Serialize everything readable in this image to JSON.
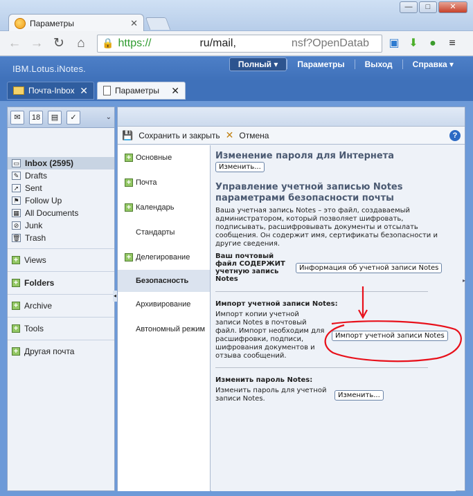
{
  "browser": {
    "tab_title": "Параметры",
    "url": {
      "scheme": "https://",
      "host": "ru/mail,",
      "path": "nsf?OpenDatab"
    },
    "window_buttons": [
      "—",
      "□",
      "✕"
    ]
  },
  "app": {
    "brand": "IBM.Lotus.iNotes.",
    "topnav": [
      {
        "label": "Полный ▾"
      },
      {
        "label": "Параметры"
      },
      {
        "label": "Выход"
      },
      {
        "label": "Справка ▾"
      }
    ],
    "tabs": [
      {
        "label": "Почта-Inbox"
      },
      {
        "label": "Параметры"
      }
    ]
  },
  "sidebar": {
    "folders": [
      {
        "label": "Inbox (2595)"
      },
      {
        "label": "Drafts"
      },
      {
        "label": "Sent"
      },
      {
        "label": "Follow Up"
      },
      {
        "label": "All Documents"
      },
      {
        "label": "Junk"
      },
      {
        "label": "Trash"
      }
    ],
    "sections": [
      {
        "label": "Views"
      },
      {
        "label": "Folders"
      },
      {
        "label": "Archive"
      },
      {
        "label": "Tools"
      },
      {
        "label": "Другая почта"
      }
    ]
  },
  "actions": {
    "save_close": "Сохранить и закрыть",
    "cancel": "Отмена",
    "help": "?"
  },
  "pref_nav": [
    {
      "label": "Основные"
    },
    {
      "label": "Почта"
    },
    {
      "label": "Календарь"
    },
    {
      "label": "Стандарты"
    },
    {
      "label": "Делегирование"
    },
    {
      "label": "Безопасность"
    },
    {
      "label": "Архивирование"
    },
    {
      "label": "Автономный режим"
    }
  ],
  "content": {
    "internet_pw_title": "Изменение пароля для Интернета",
    "change_btn": "Изменить...",
    "notes_id_title": "Управление учетной записью Notes параметрами безопасности почты",
    "notes_id_desc": "Ваша учетная запись Notes – это файл, создаваемый администратором, который позволяет шифровать, подписывать, расшифровывать документы и отсылать сообщения. Он содержит имя, сертификаты безопасности и другие сведения.",
    "mail_file_label": "Ваш почтовый файл СОДЕРЖИТ учетную запись Notes",
    "info_btn": "Информация об учетной записи Notes",
    "import_title": "Импорт учетной записи Notes:",
    "import_desc": "Импорт копии учетной записи Notes в почтовый файл. Импорт необходим для расшифровки, подписи, шифрования документов и отзыва сообщений.",
    "import_btn": "Импорт учетной записи Notes",
    "change_pw_title": "Изменить пароль Notes:",
    "change_pw_desc": "Изменить пароль для учетной записи Notes.",
    "change_pw_btn": "Изменить..."
  },
  "colors": {
    "header_blue": "#3f71ba",
    "annotation_red": "#e8101a"
  }
}
